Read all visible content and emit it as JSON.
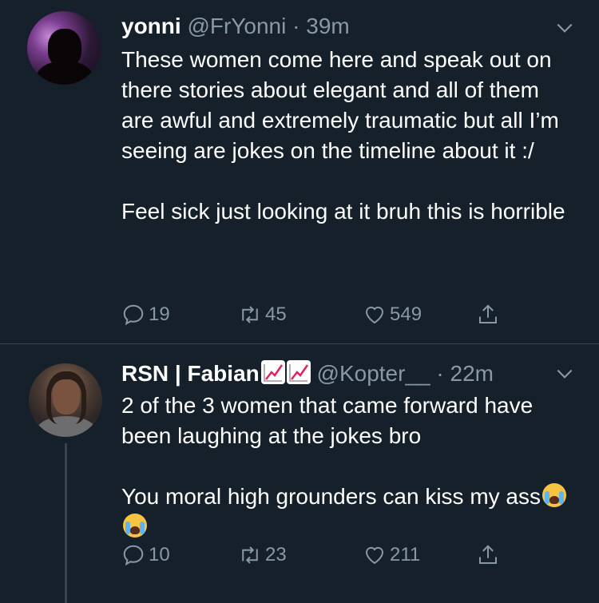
{
  "tweets": [
    {
      "name": "yonni",
      "handle": "@FrYonni",
      "time": "· 39m",
      "paragraphs": [
        "These women come here and speak out on there stories about elegant and all of them are awful and extremely traumatic but all I’m seeing are jokes on the timeline about it :/",
        "Feel sick just looking at it bruh this is horrible"
      ],
      "replies": "19",
      "retweets": "45",
      "likes": "549"
    },
    {
      "name": "RSN | Fabian",
      "name_emoji": [
        "chart-increasing-icon",
        "chart-increasing-icon"
      ],
      "handle": "@Kopter__",
      "time": "· 22m",
      "paragraphs": [
        "2 of the 3 women that came forward have been laughing at the jokes bro",
        "You moral high grounders can kiss my ass"
      ],
      "trailing_emoji": [
        "loudly-crying-face-icon",
        "loudly-crying-face-icon"
      ],
      "replies": "10",
      "retweets": "23",
      "likes": "211"
    }
  ],
  "colors": {
    "background": "#15202b",
    "text": "#ffffff",
    "secondary": "#8899a6",
    "divider": "#38444d"
  }
}
